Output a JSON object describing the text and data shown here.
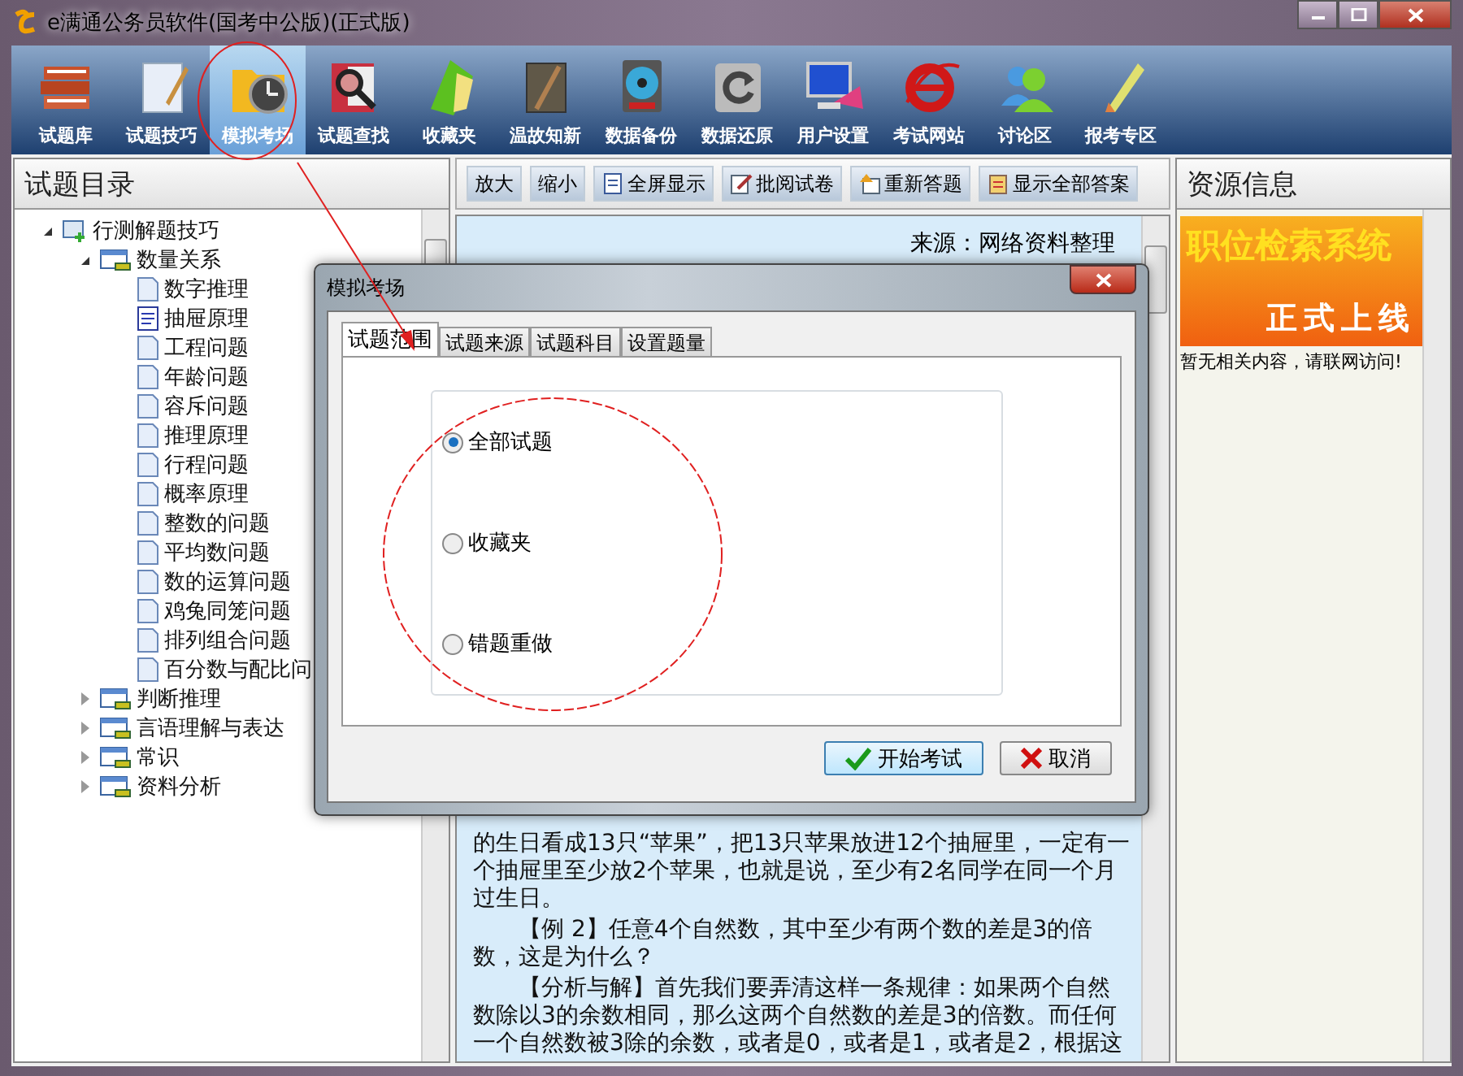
{
  "window": {
    "title": "e满通公务员软件(国考中公版)(正式版)"
  },
  "toolbar": [
    {
      "label": "试题库",
      "selected": false
    },
    {
      "label": "试题技巧",
      "selected": false
    },
    {
      "label": "模拟考场",
      "selected": true
    },
    {
      "label": "试题查找",
      "selected": false
    },
    {
      "label": "收藏夹",
      "selected": false
    },
    {
      "label": "温故知新",
      "selected": false
    },
    {
      "label": "数据备份",
      "selected": false
    },
    {
      "label": "数据还原",
      "selected": false
    },
    {
      "label": "用户设置",
      "selected": false
    },
    {
      "label": "考试网站",
      "selected": false
    },
    {
      "label": "讨论区",
      "selected": false
    },
    {
      "label": "报考专区",
      "selected": false
    }
  ],
  "catalog": {
    "title": "试题目录",
    "tree": [
      {
        "label": "行测解题技巧",
        "kind": "root",
        "expanded": true,
        "children": [
          {
            "label": "数量关系",
            "kind": "folder",
            "expanded": true,
            "children": [
              {
                "label": "数字推理",
                "kind": "page"
              },
              {
                "label": "抽屉原理",
                "kind": "document"
              },
              {
                "label": "工程问题",
                "kind": "page"
              },
              {
                "label": "年龄问题",
                "kind": "page"
              },
              {
                "label": "容斥问题",
                "kind": "page"
              },
              {
                "label": "推理原理",
                "kind": "page"
              },
              {
                "label": "行程问题",
                "kind": "page"
              },
              {
                "label": "概率原理",
                "kind": "page"
              },
              {
                "label": "整数的问题",
                "kind": "page"
              },
              {
                "label": "平均数问题",
                "kind": "page"
              },
              {
                "label": "数的运算问题",
                "kind": "page"
              },
              {
                "label": "鸡兔同笼问题",
                "kind": "page"
              },
              {
                "label": "排列组合问题",
                "kind": "page"
              },
              {
                "label": "百分数与配比问",
                "kind": "page"
              }
            ]
          },
          {
            "label": "判断推理",
            "kind": "folder",
            "expanded": false
          },
          {
            "label": "言语理解与表达",
            "kind": "folder",
            "expanded": false
          },
          {
            "label": "常识",
            "kind": "folder",
            "expanded": false
          },
          {
            "label": "资料分析",
            "kind": "folder",
            "expanded": false
          }
        ]
      }
    ]
  },
  "reader": {
    "buttons": [
      {
        "label": "放大"
      },
      {
        "label": "缩小"
      },
      {
        "label": "全屏显示"
      },
      {
        "label": "批阅试卷"
      },
      {
        "label": "重新答题"
      },
      {
        "label": "显示全部答案"
      }
    ],
    "source": "来源：网络资料整理",
    "paragraphs": [
      {
        "text": "的生日看成13只“苹果”，把13只苹果放进12个抽屉里，一定有一个抽屉里至少放2个苹果，也就是说，至少有2名同学在同一个月过生日。",
        "indent": false
      },
      {
        "text": "【例 2】任意4个自然数，其中至少有两个数的差是3的倍数，这是为什么？",
        "indent": true
      },
      {
        "text": "【分析与解】首先我们要弄清这样一条规律：如果两个自然数除以3的余数相同，那么这两个自然数的差是3的倍数。而任何一个自然数被3除的余数，或者是0，或者是1，或者是2，根据这",
        "indent": true
      }
    ]
  },
  "resources": {
    "title": "资源信息",
    "banner": {
      "headline": "职位检索系统",
      "tagline": "正式上线"
    },
    "message": "暂无相关内容，请联网访问!"
  },
  "dialog": {
    "title": "模拟考场",
    "tabs": [
      {
        "label": "试题范围",
        "selected": true
      },
      {
        "label": "试题来源",
        "selected": false
      },
      {
        "label": "试题科目",
        "selected": false
      },
      {
        "label": "设置题量",
        "selected": false
      }
    ],
    "options": [
      {
        "label": "全部试题",
        "selected": true
      },
      {
        "label": "收藏夹",
        "selected": false
      },
      {
        "label": "错题重做",
        "selected": false
      }
    ],
    "buttons": [
      {
        "label": "开始考试",
        "kind": "ok"
      },
      {
        "label": "取消",
        "kind": "cancel"
      }
    ]
  }
}
